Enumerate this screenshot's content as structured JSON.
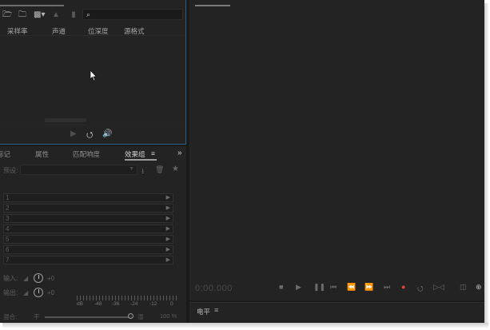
{
  "files_panel": {
    "columns": [
      "采样率",
      "声道",
      "位深度",
      "源格式"
    ]
  },
  "effects_rack": {
    "tabs": [
      "标记",
      "属性",
      "匹配响度",
      "效果组"
    ],
    "active_tab": "效果组",
    "preset_label": "预设:",
    "slot_numbers": [
      "1",
      "2",
      "3",
      "4",
      "5",
      "6",
      "7"
    ],
    "input_label": "输入:",
    "input_value": "+0",
    "output_label": "输出:",
    "output_value": "+0",
    "meter_scale": [
      "dB",
      "-48",
      "-36",
      "-24",
      "-12",
      "0"
    ],
    "mix_label": "混合:",
    "mix_dry": "干",
    "mix_wet": "湿",
    "mix_percent": "100 %"
  },
  "editor": {
    "timecode": "0:00.000"
  },
  "timeline": {
    "label": "电平"
  },
  "colors": {
    "background": "#1b1b1b",
    "panel": "#232323",
    "focus_border": "#2d5d8a",
    "record": "#e0473a"
  }
}
